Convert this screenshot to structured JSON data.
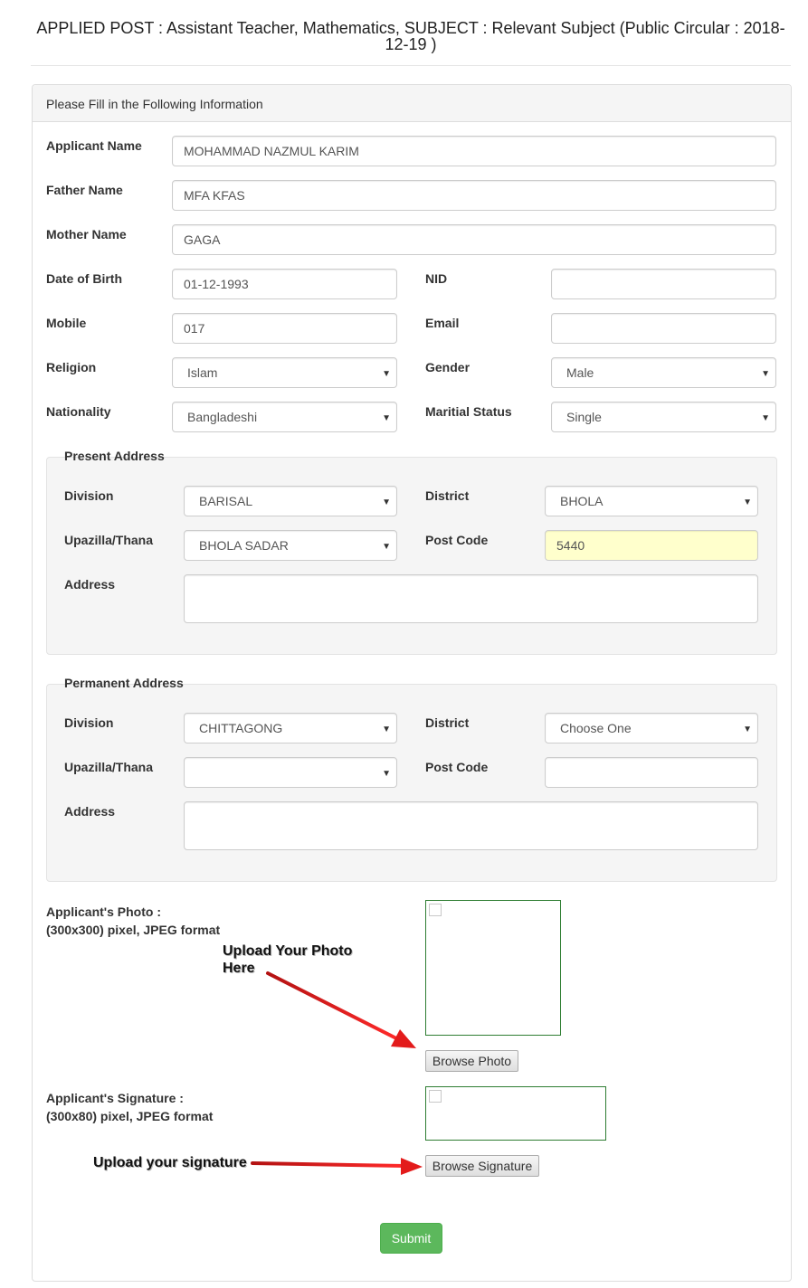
{
  "header": {
    "title_line1": "APPLIED POST : Assistant Teacher, Mathematics, SUBJECT : Relevant Subject (Public Circular : 2018-",
    "title_line2": "12-19 )"
  },
  "panel": {
    "heading": "Please Fill in the Following Information"
  },
  "fields": {
    "applicant_name": {
      "label": "Applicant Name",
      "value": "MOHAMMAD NAZMUL KARIM"
    },
    "father_name": {
      "label": "Father Name",
      "value": "MFA KFAS"
    },
    "mother_name": {
      "label": "Mother Name",
      "value": "GAGA"
    },
    "dob": {
      "label": "Date of Birth",
      "value": "01-12-1993"
    },
    "nid": {
      "label": "NID",
      "value": ""
    },
    "mobile": {
      "label": "Mobile",
      "value": "017"
    },
    "email": {
      "label": "Email",
      "value": ""
    },
    "religion": {
      "label": "Religion",
      "value": "Islam"
    },
    "gender": {
      "label": "Gender",
      "value": "Male"
    },
    "nationality": {
      "label": "Nationality",
      "value": "Bangladeshi"
    },
    "marital": {
      "label": "Maritial Status",
      "value": "Single"
    }
  },
  "present": {
    "legend": "Present Address",
    "division_label": "Division",
    "division": "BARISAL",
    "district_label": "District",
    "district": "BHOLA",
    "upazilla_label": "Upazilla/Thana",
    "upazilla": "BHOLA SADAR",
    "postcode_label": "Post Code",
    "postcode": "5440",
    "address_label": "Address",
    "address": ""
  },
  "permanent": {
    "legend": "Permanent Address",
    "division_label": "Division",
    "division": "CHITTAGONG",
    "district_label": "District",
    "district": "Choose One",
    "upazilla_label": "Upazilla/Thana",
    "upazilla": "",
    "postcode_label": "Post Code",
    "postcode": "",
    "address_label": "Address",
    "address": ""
  },
  "photo": {
    "label_line1": "Applicant's Photo :",
    "label_line2": "(300x300) pixel, JPEG format",
    "button": "Browse Photo",
    "annotation_line1": "Upload Your Photo",
    "annotation_line2": "Here"
  },
  "signature": {
    "label_line1": "Applicant's Signature :",
    "label_line2": "(300x80) pixel, JPEG format",
    "button": "Browse Signature",
    "annotation": "Upload your signature"
  },
  "submit": "Submit",
  "colors": {
    "submit_bg": "#5cb85c",
    "highlight_input": "#ffffcc",
    "image_border": "#2e7d32",
    "arrow": "#e31b1b"
  },
  "icons": {
    "select_caret": "caret-down-icon",
    "broken_image": "broken-image-icon"
  }
}
